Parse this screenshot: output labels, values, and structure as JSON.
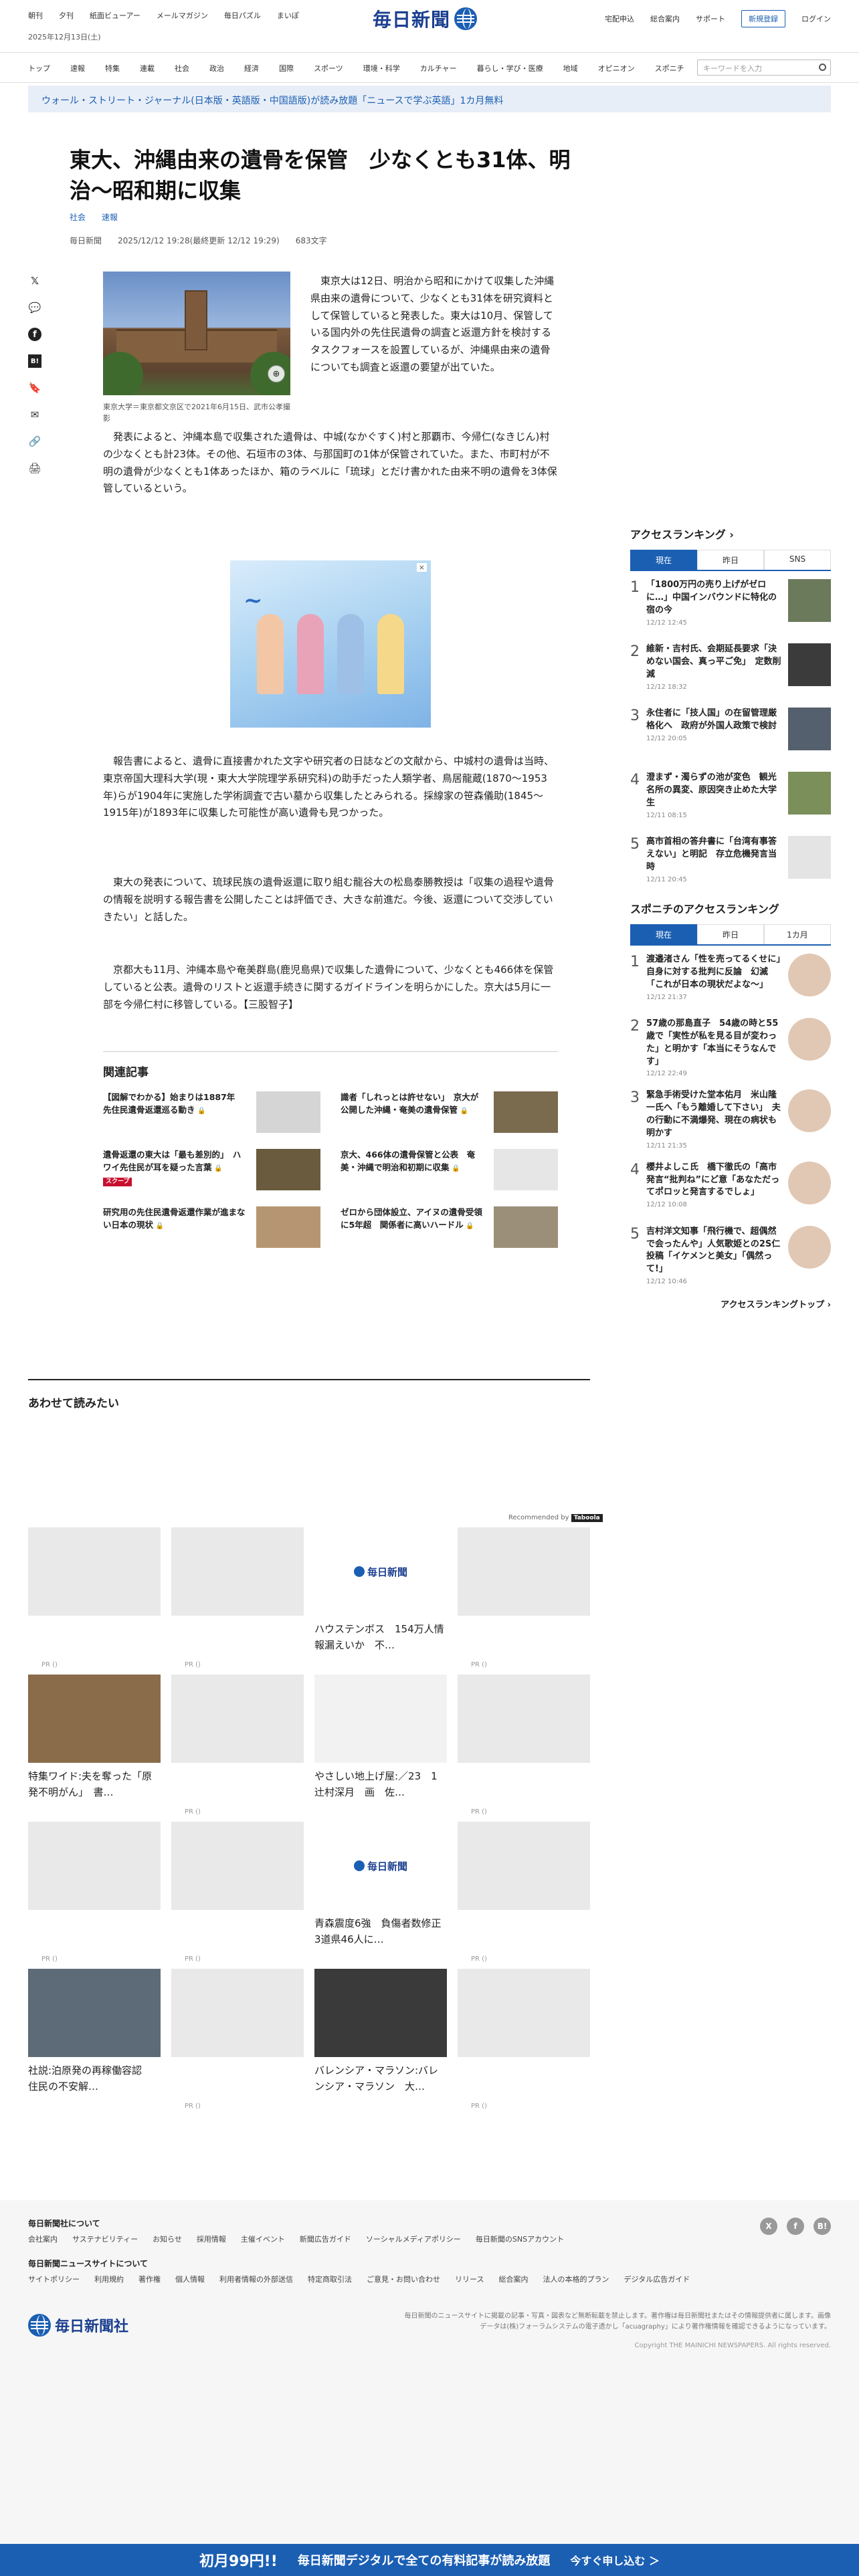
{
  "header": {
    "left_links": [
      "朝刊",
      "夕刊",
      "紙面ビューアー",
      "メールマガジン",
      "毎日パズル",
      "まいぽ"
    ],
    "date": "2025年12月13日(土)",
    "logo": "毎日新聞",
    "right_links": [
      "宅配申込",
      "総合案内",
      "サポート"
    ],
    "register": "新規登録",
    "login": "ログイン"
  },
  "nav": {
    "items": [
      "トップ",
      "速報",
      "特集",
      "連載",
      "社会",
      "政治",
      "経済",
      "国際",
      "スポーツ",
      "環境・科学",
      "カルチャー",
      "暮らし・学び・医療",
      "地域",
      "オピニオン",
      "スポニチ"
    ],
    "search_placeholder": "キーワードを入力"
  },
  "banner": "ウォール・ストリート・ジャーナル(日本版・英語版・中国語版)が読み放題「ニュースで学ぶ英語」1カ月無料",
  "article": {
    "title": "東大、沖縄由来の遺骨を保管　少なくとも31体、明治～昭和期に収集",
    "tags": [
      "社会",
      "速報"
    ],
    "source": "毎日新聞",
    "date": "2025/12/12 19:28(最終更新 12/12 19:29)",
    "chars": "683文字",
    "caption": "東京大学＝東京都文京区で2021年6月15日、武市公孝撮影",
    "p1": "東京大は12日、明治から昭和にかけて収集した沖縄県由来の遺骨について、少なくとも31体を研究資料として保管していると発表した。東大は10月、保管している国内外の先住民遺骨の調査と返還方針を検討するタスクフォースを設置しているが、沖縄県由来の遺骨についても調査と返還の要望が出ていた。",
    "p2": "発表によると、沖縄本島で収集された遺骨は、中城(なかぐすく)村と那覇市、今帰仁(なきじん)村の少なくとも計23体。その他、石垣市の3体、与那国町の1体が保管されていた。また、市町村が不明の遺骨が少なくとも1体あったほか、箱のラベルに「琉球」とだけ書かれた由来不明の遺骨を3体保管しているという。",
    "p3": "報告書によると、遺骨に直接書かれた文字や研究者の日誌などの文献から、中城村の遺骨は当時、東京帝国大理科大学(現・東大大学院理学系研究科)の助手だった人類学者、鳥居龍蔵(1870～1953年)らが1904年に実施した学術調査で古い墓から収集したとみられる。採線家の笹森儀助(1845～1915年)が1893年に収集した可能性が高い遺骨も見つかった。",
    "p4": "東大の発表について、琉球民族の遺骨返還に取り組む龍谷大の松島泰勝教授は「収集の過程や遺骨の情報を説明する報告書を公開したことは評価でき、大きな前進だ。今後、返還について交渉していきたい」と話した。",
    "p5": "京都大も11月、沖縄本島や奄美群島(鹿児島県)で収集した遺骨について、少なくとも466体を保管していると公表。遺骨のリストと返還手続きに関するガイドラインを明らかにした。京大は5月に一部を今帰仁村に移管している。【三股智子】"
  },
  "related": {
    "heading": "関連記事",
    "items": [
      {
        "title": "【図解でわかる】始まりは1887年　先住民遺骨返還巡る動き",
        "thumb": "#d5d5d5",
        "scoop": ""
      },
      {
        "title": "識者「しれっとは許せない」　京大が公開した沖縄・奄美の遺骨保管",
        "thumb": "#7a6a4e",
        "scoop": ""
      },
      {
        "title": "遺骨返還の東大は「最も差別的」　ハワイ先住民が耳を疑った言葉",
        "thumb": "#6a5b3e",
        "scoop": "スクープ"
      },
      {
        "title": "京大、466体の遺骨保管と公表　奄美・沖縄で明治和初期に収集",
        "thumb": "#e6e6e6",
        "scoop": ""
      },
      {
        "title": "研究用の先住民遺骨返還作業が進まない日本の現状",
        "thumb": "#b69672",
        "scoop": ""
      },
      {
        "title": "ゼロから団体設立、アイヌの遺骨受領に5年超　関係者に高いハードル",
        "thumb": "#9c8f7a",
        "scoop": ""
      }
    ]
  },
  "recommend": {
    "heading": "あわせて読みたい",
    "label": "Recommended by",
    "brand": "Taboola",
    "cards": [
      {
        "text": "",
        "pr": "PR ()",
        "kind": "blank"
      },
      {
        "text": "",
        "pr": "PR ()",
        "kind": "blank"
      },
      {
        "text": "ハウステンボス　154万人情報漏えいか　不…",
        "pr": "",
        "kind": "logo"
      },
      {
        "text": "",
        "pr": "PR ()",
        "kind": "blank"
      },
      {
        "text": "特集ワイド:夫を奪った「原発不明がん」　書…",
        "pr": "",
        "kind": "photo",
        "color": "#8a6b4a"
      },
      {
        "text": "",
        "pr": "PR ()",
        "kind": "blank"
      },
      {
        "text": "やさしい地上げ屋:／23　1　辻村深月　画　佐…",
        "pr": "",
        "kind": "photo",
        "color": "#f2f2f2"
      },
      {
        "text": "",
        "pr": "PR ()",
        "kind": "blank"
      },
      {
        "text": "",
        "pr": "PR ()",
        "kind": "blank"
      },
      {
        "text": "",
        "pr": "PR ()",
        "kind": "blank"
      },
      {
        "text": "青森震度6強　負傷者数修正　3道県46人に…",
        "pr": "",
        "kind": "logo"
      },
      {
        "text": "",
        "pr": "PR ()",
        "kind": "blank"
      },
      {
        "text": "社説:泊原発の再稼働容認　住民の不安解…",
        "pr": "",
        "kind": "photo",
        "color": "#5d6b78"
      },
      {
        "text": "",
        "pr": "PR ()",
        "kind": "blank"
      },
      {
        "text": "バレンシア・マラソン:バレンシア・マラソン　大…",
        "pr": "",
        "kind": "photo",
        "color": "#3a3a3a"
      },
      {
        "text": "",
        "pr": "PR ()",
        "kind": "blank"
      }
    ]
  },
  "ranking": {
    "heading": "アクセスランキング",
    "tabs": [
      "現在",
      "昨日",
      "SNS"
    ],
    "items": [
      {
        "no": "1",
        "title": "「1800万円の売り上げがゼロに…」中国インバウンドに特化の宿の今",
        "time": "12/12 12:45",
        "color": "#6b7a5a"
      },
      {
        "no": "2",
        "title": "維新・吉村氏、会期延長要求「決めない国会、真っ平ご免」　定数削減",
        "time": "12/12 18:32",
        "color": "#3b3b3b"
      },
      {
        "no": "3",
        "title": "永住者に「技人国」の在留管理厳格化へ　政府が外国人政策で検討",
        "time": "12/12 20:05",
        "color": "#55606e"
      },
      {
        "no": "4",
        "title": "澄まず・濁らずの池が変色　観光名所の異変、原因突き止めた大学生",
        "time": "12/11 08:15",
        "color": "#7b8f5a"
      },
      {
        "no": "5",
        "title": "高市首相の答弁書に「台湾有事答えない」と明記　存立危機発言当時",
        "time": "12/11 20:45",
        "color": "#e4e4e4"
      }
    ],
    "more": ""
  },
  "sponichi": {
    "heading": "スポニチのアクセスランキング",
    "tabs": [
      "現在",
      "昨日",
      "1カ月"
    ],
    "items": [
      {
        "no": "1",
        "title": "渡邉渚さん「性を売ってるくせに」自身に対する批判に反論　幻滅「これが日本の現状だよな～」",
        "time": "12/12 21:37"
      },
      {
        "no": "2",
        "title": "57歳の那島直子　54歳の時と55歳で「実性が私を見る目が変わった」と明かす「本当にそうなんです」",
        "time": "12/12 22:49"
      },
      {
        "no": "3",
        "title": "緊急手術受けた堂本佑月　米山隆一氏へ「もう離婚して下さい」　夫の行動に不満爆発、現在の病状も明かす",
        "time": "12/11 21:35"
      },
      {
        "no": "4",
        "title": "櫻井よしこ氏　橋下徹氏の「高市発言“批判ね”にど意「あなただってポロッと発言するでしょ」",
        "time": "12/12 10:08"
      },
      {
        "no": "5",
        "title": "吉村洋文知事「飛行機で、超偶然で会ったんや」人気歌姫との2S仁投稿「イケメンと美女」「偶然って!」",
        "time": "12/12 10:46"
      }
    ],
    "more": "アクセスランキングトップ"
  },
  "footer": {
    "about_heading": "毎日新聞社について",
    "about_links": [
      "会社案内",
      "サステナビリティー",
      "お知らせ",
      "採用情報",
      "主催イベント",
      "新聞広告ガイド",
      "ソーシャルメディアポリシー",
      "毎日新聞のSNSアカウント"
    ],
    "site_heading": "毎日新聞ニュースサイトについて",
    "site_links": [
      "サイトポリシー",
      "利用規約",
      "著作権",
      "個人情報",
      "利用者情報の外部送信",
      "特定商取引法",
      "ご意見・お問い合わせ",
      "リリース",
      "総合案内",
      "法人の本格的プラン",
      "デジタル広告ガイド"
    ],
    "logo": "毎日新聞社",
    "note": "毎日新聞のニュースサイトに掲載の記事・写真・図表など無断転載を禁止します。著作権は毎日新聞社またはその情報提供者に属します。画像データは(株)フォーラムシステムの電子透かし「acuagraphy」により著作権情報を確認できるようになっています。",
    "copyright": "Copyright THE MAINICHI NEWSPAPERS. All rights reserved.",
    "social": [
      "X",
      "f",
      "B!"
    ]
  },
  "cta": {
    "first": "初月99円!!",
    "text": "毎日新聞デジタルで全ての有料記事が読み放題",
    "go": "今すぐ申し込む ＞"
  },
  "colors": {
    "brand": "#1b5fb3",
    "logo": "#1b3f8f",
    "scoop": "#c8102e"
  }
}
